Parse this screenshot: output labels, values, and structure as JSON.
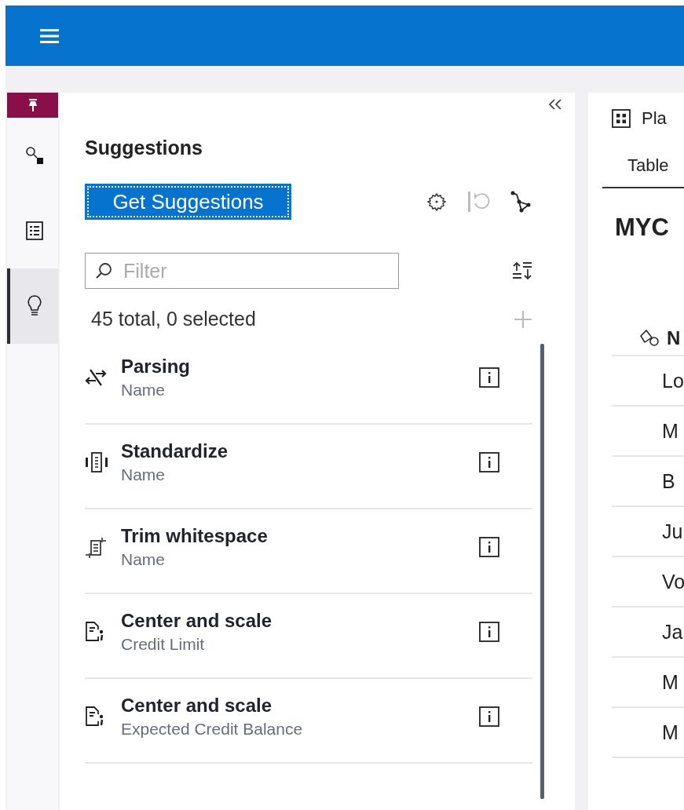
{
  "rail": {
    "items": [
      {
        "kind": "search",
        "selected": false
      },
      {
        "kind": "list",
        "selected": false
      },
      {
        "kind": "bulb",
        "selected": true
      }
    ]
  },
  "suggestions": {
    "title": "Suggestions",
    "button": "Get Suggestions",
    "filter": {
      "placeholder": "Filter"
    },
    "count": "45 total, 0 selected",
    "items": [
      {
        "kind": "parse",
        "title": "Parsing",
        "column": "Name"
      },
      {
        "kind": "standardize",
        "title": "Standardize",
        "column": "Name"
      },
      {
        "kind": "trim",
        "title": "Trim whitespace",
        "column": "Name"
      },
      {
        "kind": "center",
        "title": "Center and scale",
        "column": "Credit Limit"
      },
      {
        "kind": "center",
        "title": "Center and scale",
        "column": "Expected Credit Balance"
      }
    ]
  },
  "right": {
    "plan": "Pla",
    "tabs": [
      {
        "label": "Table",
        "selected": true
      }
    ],
    "table_name": "MYC",
    "column": "N",
    "rows": [
      "Lo",
      "M",
      "B",
      "Ju",
      "Vo",
      "Ja",
      "M",
      "M"
    ]
  }
}
